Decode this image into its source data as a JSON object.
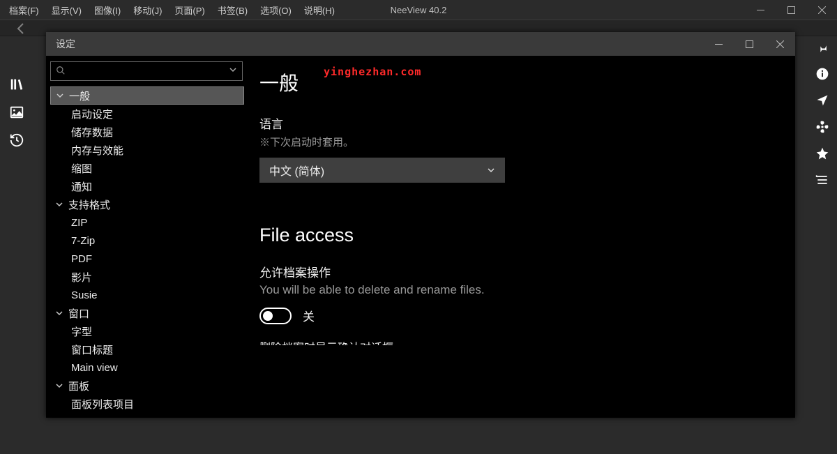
{
  "menubar": {
    "items": [
      "档案(F)",
      "显示(V)",
      "图像(I)",
      "移动(J)",
      "页面(P)",
      "书签(B)",
      "选项(O)",
      "说明(H)"
    ],
    "title": "NeeView 40.2"
  },
  "dialog": {
    "title": "设定"
  },
  "search": {
    "placeholder": ""
  },
  "tree": {
    "items": [
      {
        "label": "一般",
        "level": 0,
        "expandable": true,
        "selected": true
      },
      {
        "label": "启动设定",
        "level": 1
      },
      {
        "label": "储存数据",
        "level": 1
      },
      {
        "label": "内存与效能",
        "level": 1
      },
      {
        "label": "缩图",
        "level": 1
      },
      {
        "label": "通知",
        "level": 1
      },
      {
        "label": "支持格式",
        "level": 0,
        "expandable": true
      },
      {
        "label": "ZIP",
        "level": 1
      },
      {
        "label": "7-Zip",
        "level": 1
      },
      {
        "label": "PDF",
        "level": 1
      },
      {
        "label": "影片",
        "level": 1
      },
      {
        "label": "Susie",
        "level": 1
      },
      {
        "label": "窗口",
        "level": 0,
        "expandable": true
      },
      {
        "label": "字型",
        "level": 1
      },
      {
        "label": "窗口标题",
        "level": 1
      },
      {
        "label": "Main view",
        "level": 1
      },
      {
        "label": "面板",
        "level": 0,
        "expandable": true
      },
      {
        "label": "面板列表项目",
        "level": 1
      }
    ]
  },
  "content": {
    "watermark": "yinghezhan.com",
    "heading1": "一般",
    "language_label": "语言",
    "language_hint": "※下次启动时套用。",
    "language_value": "中文 (简体)",
    "heading2": "File access",
    "fileop_label": "允许档案操作",
    "fileop_desc": "You will be able to delete and rename files.",
    "toggle_state": "关",
    "cutoff_label": "删除档案时显示确认对话框"
  }
}
